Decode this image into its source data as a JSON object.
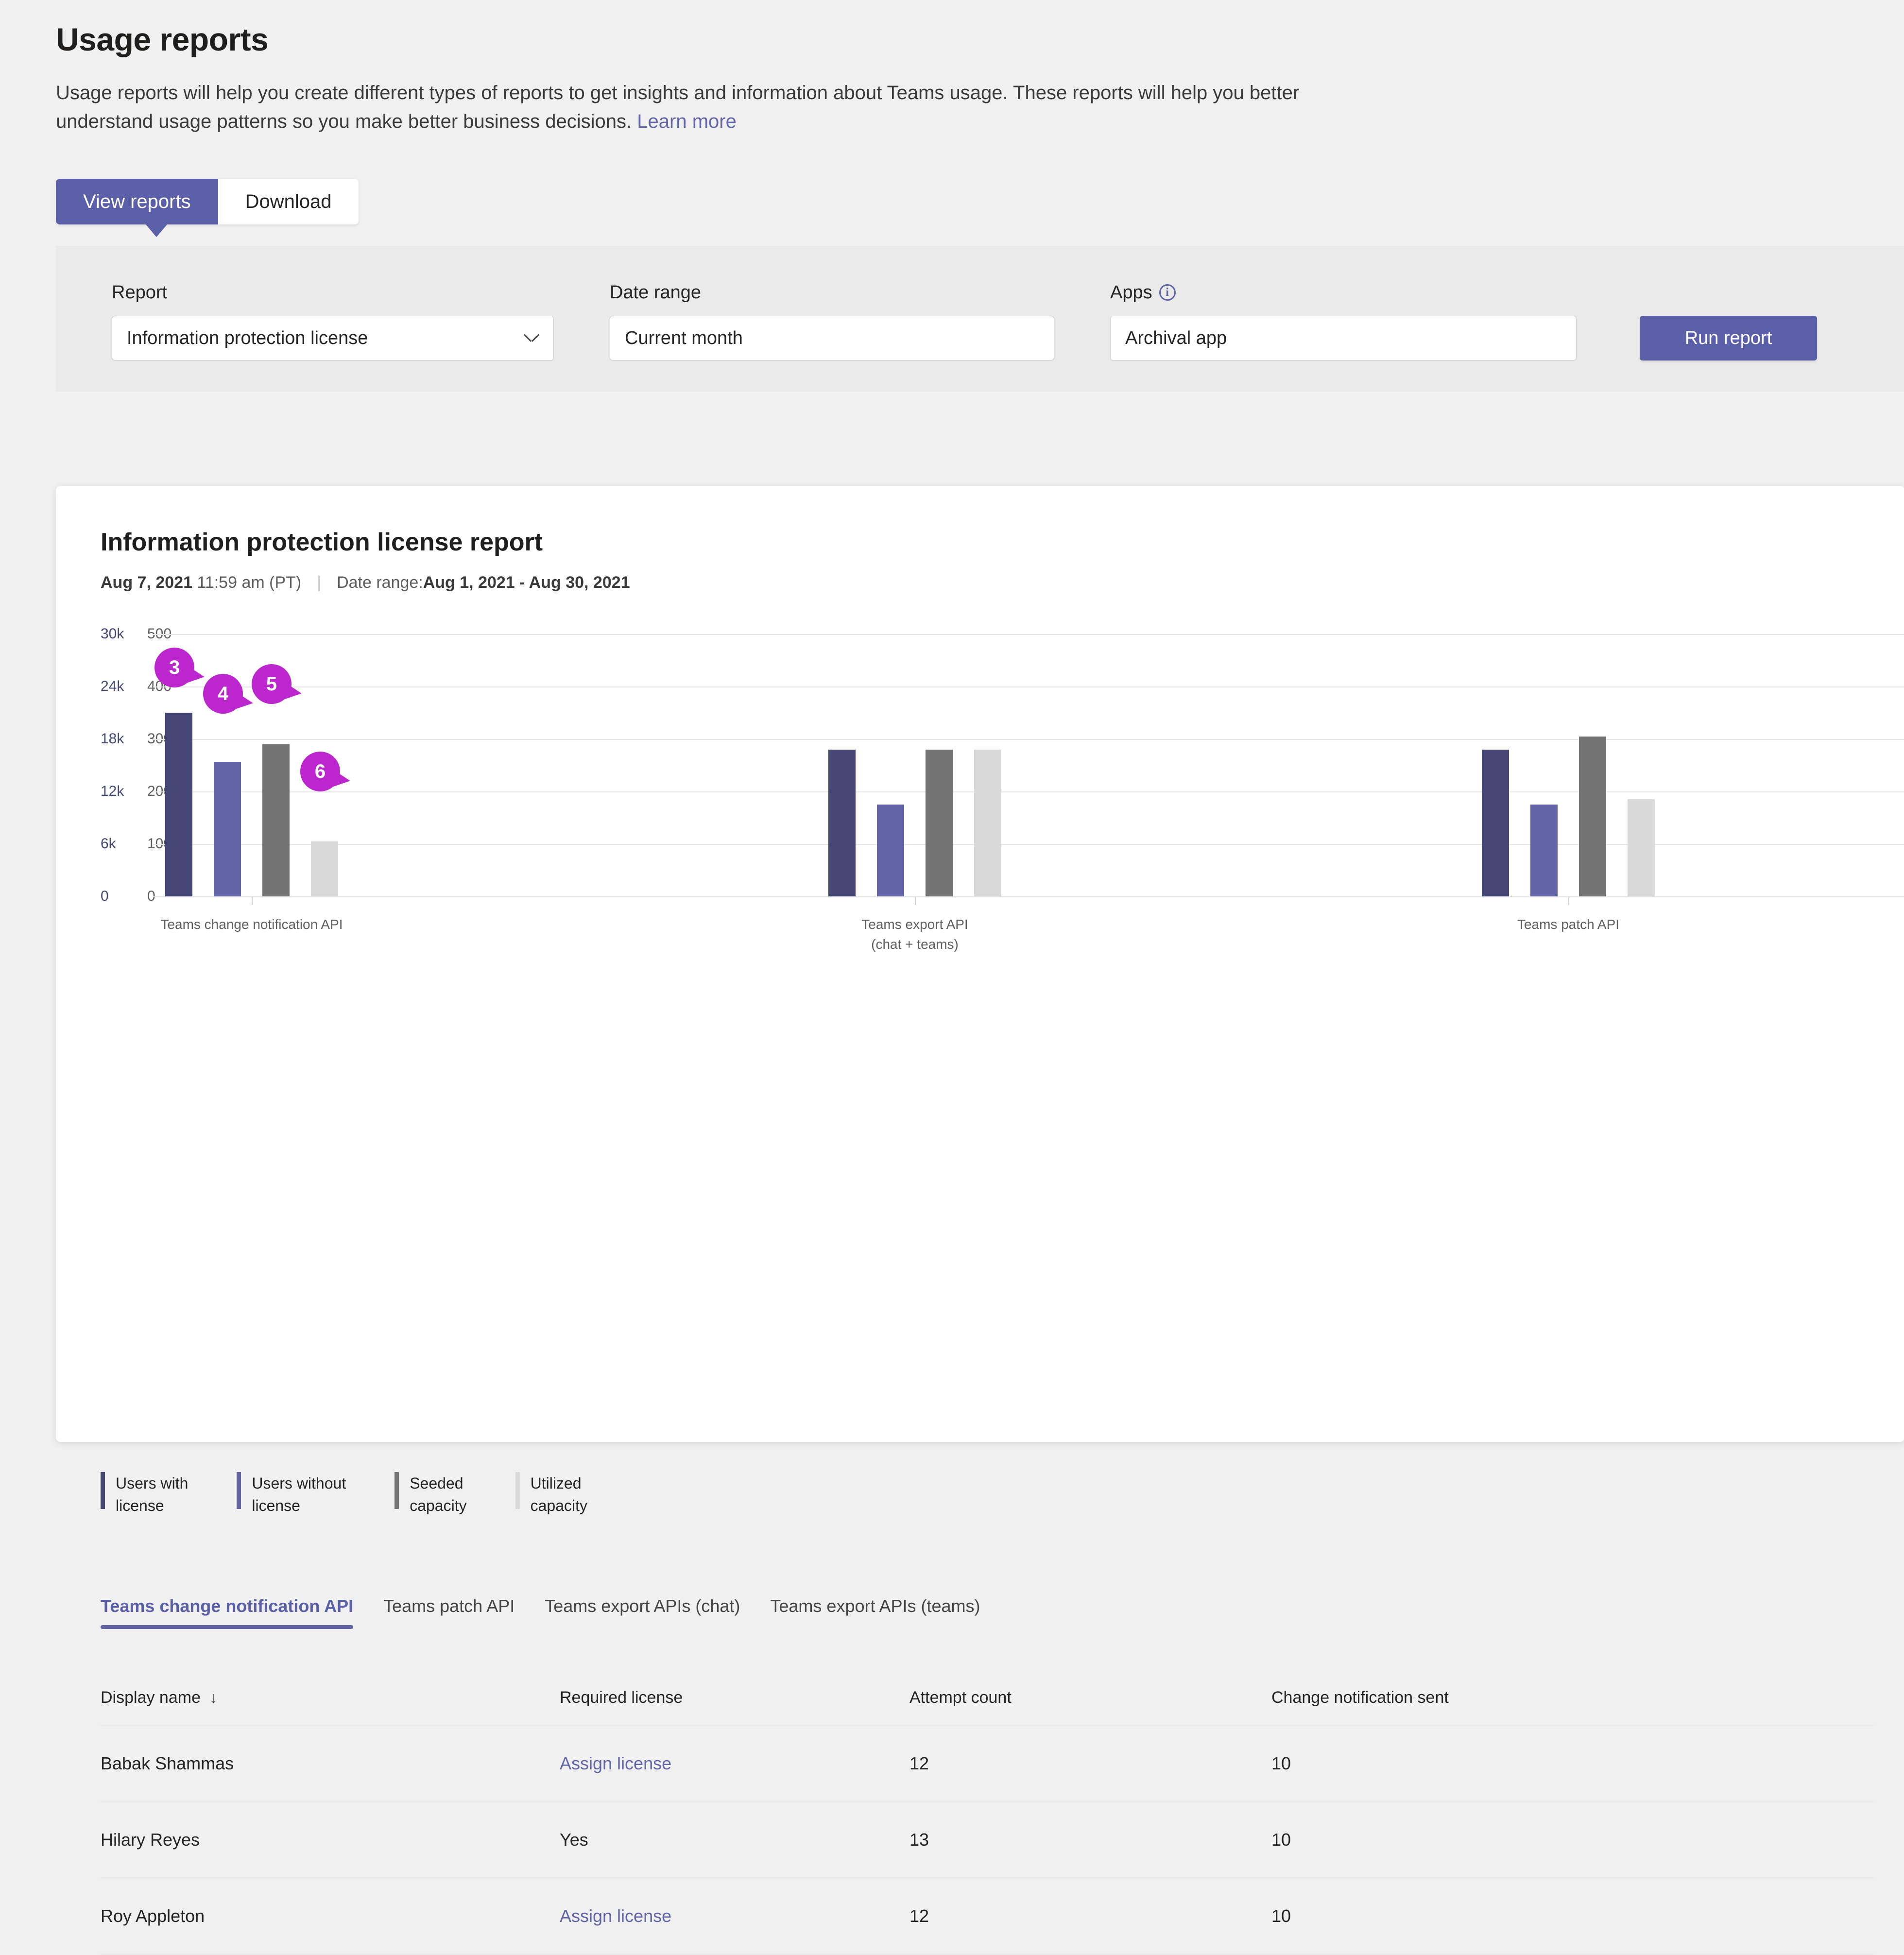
{
  "header": {
    "title": "Usage reports",
    "description": "Usage reports will help you create different types of reports to get insights and information about Teams usage. These reports will help you better understand usage patterns so you make better business decisions.",
    "learn_more": "Learn more"
  },
  "pivot": {
    "view_reports": "View reports",
    "download": "Download"
  },
  "filters": {
    "report_label": "Report",
    "report_value": "Information protection license",
    "daterange_label": "Date range",
    "daterange_value": "Current month",
    "apps_label": "Apps",
    "apps_info_glyph": "i",
    "apps_value": "Archival app",
    "run_button": "Run report"
  },
  "report": {
    "title": "Information protection license report",
    "generated_date": "Aug 7, 2021",
    "generated_time": "11:59 am (PT)",
    "separator": "|",
    "daterange_prefix": "Date range: ",
    "daterange_value": "Aug 1, 2021 - Aug 30, 2021"
  },
  "chart_data": {
    "type": "bar",
    "title": "Information protection license report",
    "grid": true,
    "legend_position": "bottom",
    "categories": [
      "Teams change notification API",
      "Teams export API\n(chat + teams)",
      "Teams patch API"
    ],
    "category_labels": [
      {
        "line1": "Teams change notification API",
        "line2": ""
      },
      {
        "line1": "Teams export API",
        "line2": "(chat + teams)"
      },
      {
        "line1": "Teams patch API",
        "line2": ""
      }
    ],
    "left_axis": {
      "label": "",
      "ticks": [
        "30k",
        "24k",
        "18k",
        "12k",
        "6k",
        "0"
      ],
      "values": [
        30000,
        24000,
        18000,
        12000,
        6000,
        0
      ],
      "ylim": [
        0,
        30000
      ],
      "color": "#464775"
    },
    "right_axis": {
      "label": "",
      "ticks": [
        "500",
        "400",
        "300",
        "200",
        "100",
        "0"
      ],
      "values": [
        500,
        400,
        300,
        200,
        100,
        0
      ],
      "ylim": [
        0,
        500
      ],
      "color": "#605e5c"
    },
    "series": [
      {
        "name": "Users with license",
        "color": "#464775",
        "axis": "left",
        "values": [
          21000,
          16800,
          16800
        ]
      },
      {
        "name": "Users without license",
        "color": "#6264a7",
        "axis": "left",
        "values": [
          15400,
          10500,
          10500
        ]
      },
      {
        "name": "Seeded capacity",
        "color": "#737373",
        "axis": "right",
        "values": [
          290,
          280,
          305
        ]
      },
      {
        "name": "Utilized capacity",
        "color": "#d9d9d9",
        "axis": "right",
        "values": [
          105,
          280,
          185
        ]
      }
    ],
    "annotations": [
      {
        "id": "3",
        "label": "3",
        "target": "Users with license"
      },
      {
        "id": "4",
        "label": "4",
        "target": "Users without license"
      },
      {
        "id": "5",
        "label": "5",
        "target": "Seeded capacity"
      },
      {
        "id": "6",
        "label": "6",
        "target": "Utilized capacity"
      }
    ],
    "annotation_color": "#bb26cd"
  },
  "legend": [
    {
      "line1": "Users with",
      "line2": "license",
      "color": "#464775"
    },
    {
      "line1": "Users without",
      "line2": "license",
      "color": "#6264a7"
    },
    {
      "line1": "Seeded",
      "line2": "capacity",
      "color": "#737373"
    },
    {
      "line1": "Utilized",
      "line2": "capacity",
      "color": "#d9d9d9"
    }
  ],
  "tabs": [
    {
      "label": "Teams change notification API",
      "active": true
    },
    {
      "label": "Teams patch API",
      "active": false
    },
    {
      "label": "Teams export APIs (chat)",
      "active": false
    },
    {
      "label": "Teams export APIs (teams)",
      "active": false
    }
  ],
  "table": {
    "columns": [
      "Display name",
      "Required license",
      "Attempt count",
      "Change notification sent"
    ],
    "sort_arrow": "↓",
    "rows": [
      {
        "display_name": "Babak Shammas",
        "required_license": "Assign license",
        "license_is_link": true,
        "attempt_count": "12",
        "change_notification_sent": "10"
      },
      {
        "display_name": "Hilary Reyes",
        "required_license": "Yes",
        "license_is_link": false,
        "attempt_count": "13",
        "change_notification_sent": "10"
      },
      {
        "display_name": "Roy Appleton",
        "required_license": "Assign license",
        "license_is_link": true,
        "attempt_count": "12",
        "change_notification_sent": "10"
      }
    ]
  }
}
